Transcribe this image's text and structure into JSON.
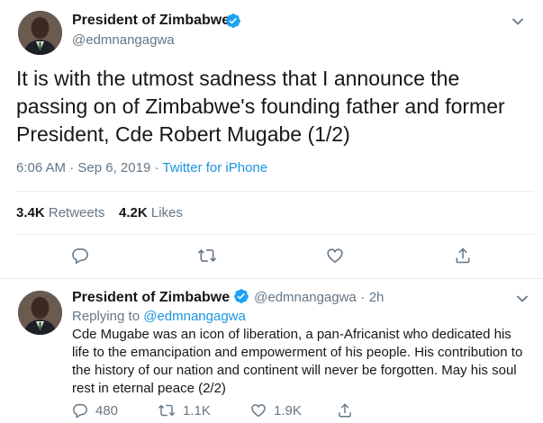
{
  "main_tweet": {
    "display_name": "President of Zimbabwe",
    "handle": "@edmnangagwa",
    "text_lines": [
      "It is with the utmost sadness that I announce the",
      "passing on of Zimbabwe's founding father and former",
      "President, Cde Robert Mugabe (1/2)"
    ],
    "time": "6:06 AM",
    "date": "Sep 6, 2019",
    "source": "Twitter for iPhone",
    "retweets_count": "3.4K",
    "retweets_label": "Retweets",
    "likes_count": "4.2K",
    "likes_label": "Likes"
  },
  "reply_tweet": {
    "display_name": "President of Zimbabwe",
    "handle": "@edmnangagwa",
    "age": "2h",
    "replying_label": "Replying to",
    "replying_handle": "@edmnangagwa",
    "text_lines": [
      "Cde Mugabe was an icon of liberation, a pan-Africanist who dedicated his",
      "life to the emancipation and empowerment of his people. His contribution to",
      "the history of our nation and continent will never be forgotten. May his soul",
      "rest in eternal peace (2/2)"
    ],
    "reply_count": "480",
    "retweet_count": "1.1K",
    "like_count": "1.9K"
  },
  "colors": {
    "accent": "#1b95e0",
    "muted": "#657786",
    "divider": "#e6ecf0",
    "verified": "#1da1f2"
  },
  "icons": [
    "verified-badge-icon",
    "chevron-down-icon",
    "reply-icon",
    "retweet-icon",
    "like-icon",
    "share-icon"
  ]
}
